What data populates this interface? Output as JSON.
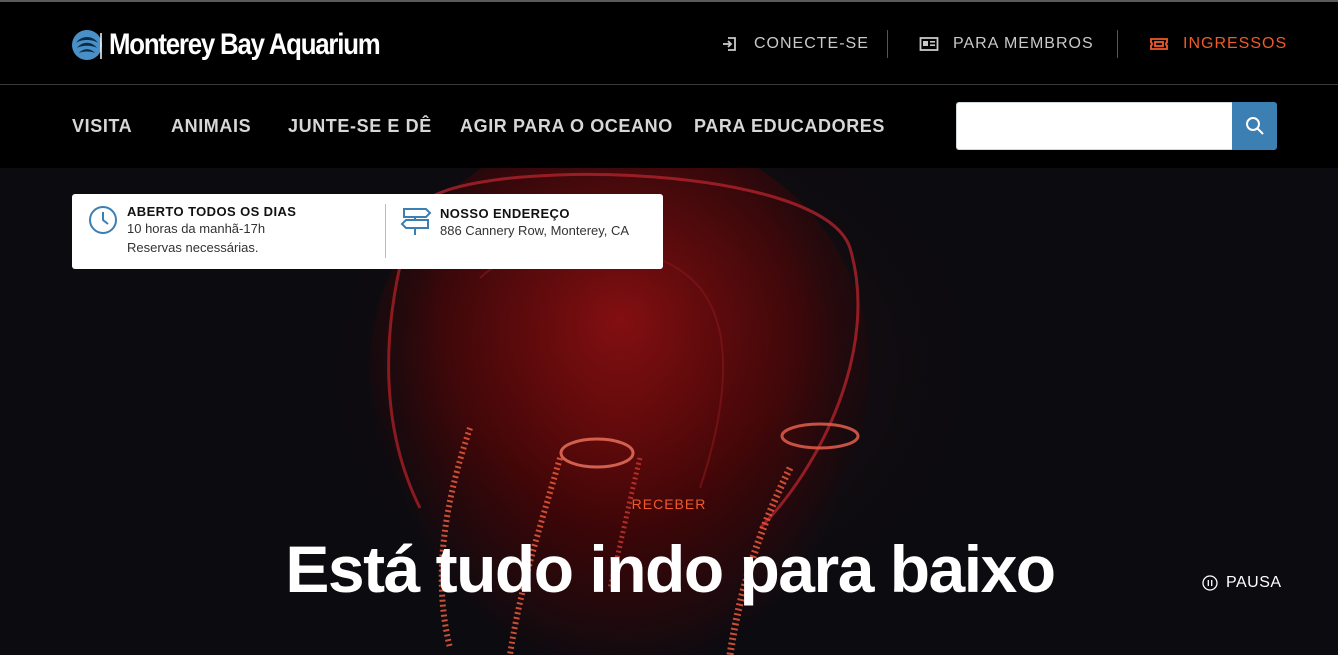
{
  "brand": {
    "name": "Monterey Bay Aquarium",
    "accent": "#f05a28",
    "search_blue": "#3b7fb3"
  },
  "utility_nav": {
    "login": {
      "label": "CONECTE-SE",
      "icon": "sign-in-icon"
    },
    "members": {
      "label": "PARA MEMBROS",
      "icon": "member-card-icon"
    },
    "tickets": {
      "label": "INGRESSOS",
      "icon": "ticket-icon"
    }
  },
  "main_nav": {
    "items": [
      {
        "label": "VISITA"
      },
      {
        "label": "ANIMAIS"
      },
      {
        "label": "JUNTE-SE E DÊ"
      },
      {
        "label": "AGIR PARA O OCEANO"
      },
      {
        "label": "PARA EDUCADORES"
      }
    ]
  },
  "search": {
    "value": "",
    "placeholder": "",
    "icon": "search-icon"
  },
  "info_card": {
    "hours": {
      "title": "ABERTO TODOS OS DIAS",
      "line1": "10 horas da manhã-17h",
      "line2": "Reservas necessárias.",
      "icon": "clock-icon"
    },
    "address": {
      "title": "NOSSO ENDEREÇO",
      "line1": "886 Cannery Row, Monterey, CA",
      "icon": "signpost-icon"
    }
  },
  "hero": {
    "eyebrow": "RECEBER",
    "headline": "Está tudo indo para baixo",
    "pause_label": "PAUSA",
    "pause_icon": "pause-icon"
  }
}
